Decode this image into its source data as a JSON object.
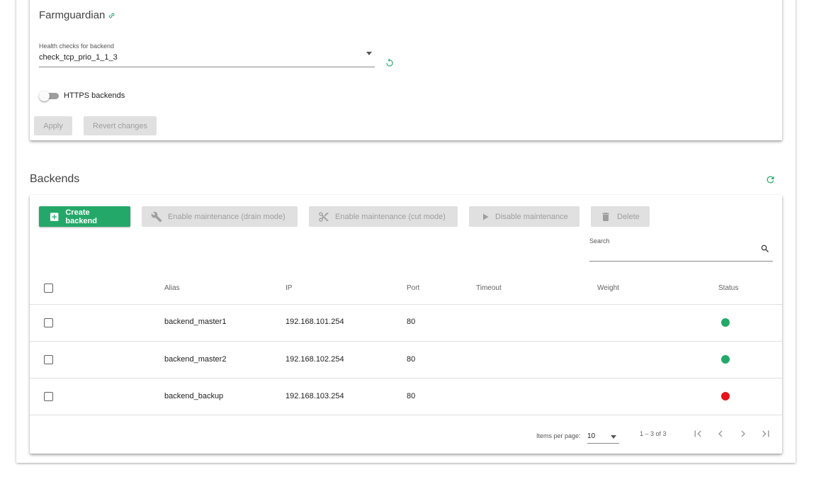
{
  "farmguardian": {
    "title": "Farmguardian",
    "link_icon": "link-icon",
    "health_label": "Health checks for backend",
    "health_value": "check_tcp_prio_1_1_3",
    "https_label": "HTTPS backends",
    "https_enabled": false,
    "apply_label": "Apply",
    "revert_label": "Revert changes"
  },
  "backends": {
    "title": "Backends",
    "toolbar": {
      "create_label": "Create backend",
      "drain_label": "Enable maintenance (drain mode)",
      "cut_label": "Enable maintenance (cut mode)",
      "disable_label": "Disable maintenance",
      "delete_label": "Delete"
    },
    "search": {
      "label": "Search",
      "value": ""
    },
    "columns": [
      "Alias",
      "IP",
      "Port",
      "Timeout",
      "Weight",
      "Status"
    ],
    "rows": [
      {
        "alias": "backend_master1",
        "ip": "192.168.101.254",
        "port": "80",
        "timeout": "",
        "weight": "",
        "status": "up",
        "status_color": "#24a869"
      },
      {
        "alias": "backend_master2",
        "ip": "192.168.102.254",
        "port": "80",
        "timeout": "",
        "weight": "",
        "status": "up",
        "status_color": "#24a869"
      },
      {
        "alias": "backend_backup",
        "ip": "192.168.103.254",
        "port": "80",
        "timeout": "",
        "weight": "",
        "status": "down",
        "status_color": "#e5141c"
      }
    ],
    "paginator": {
      "items_per_page_label": "Items per page:",
      "items_per_page": "10",
      "range": "1 – 3 of 3"
    }
  },
  "colors": {
    "accent": "#24a869",
    "disabled_bg": "#e0e0e0",
    "disabled_text": "#9e9e9e"
  }
}
